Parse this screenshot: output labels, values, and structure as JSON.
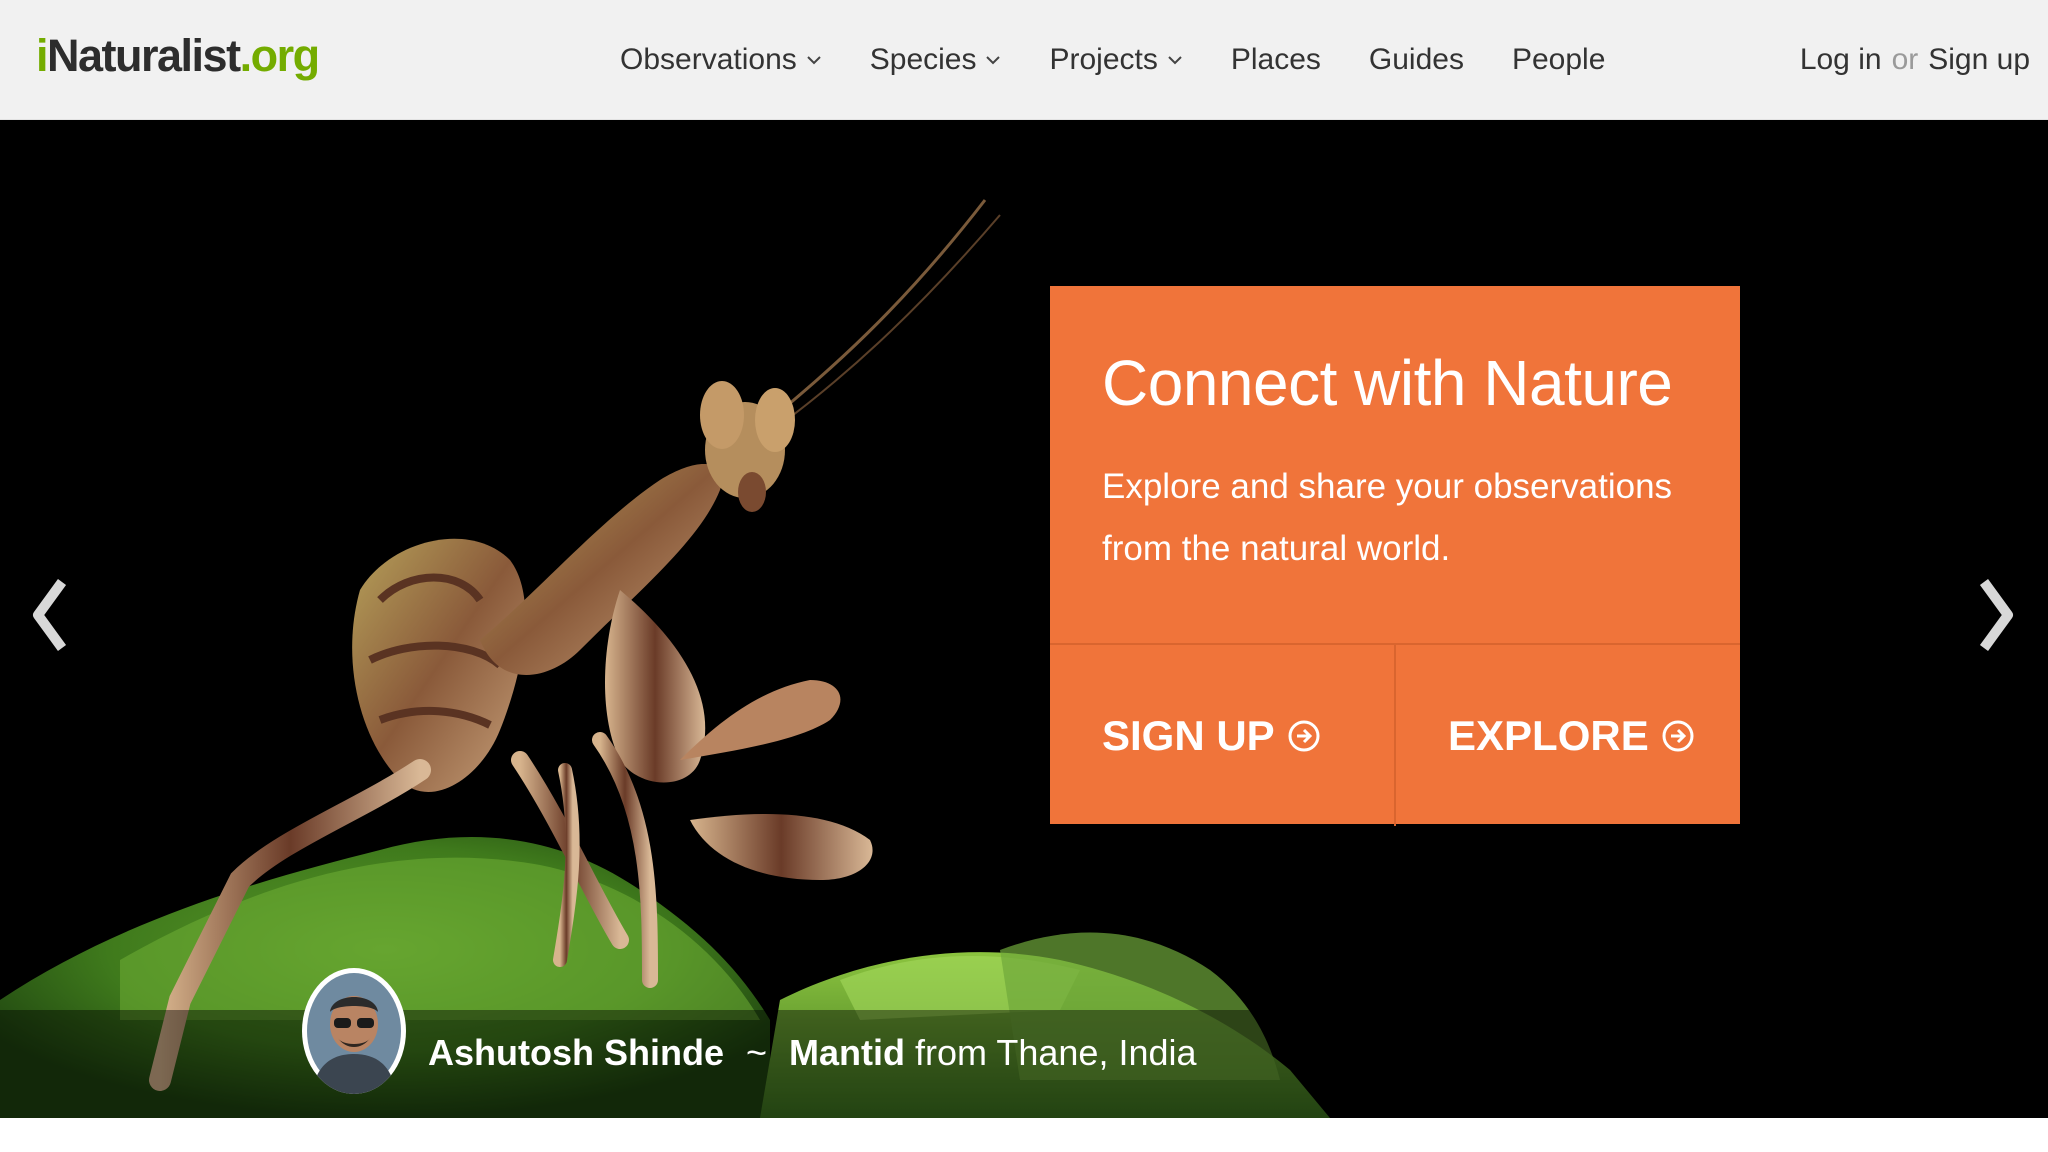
{
  "header": {
    "logo": {
      "prefix": "i",
      "main": "Naturalist",
      "suffix": ".org"
    },
    "nav": [
      {
        "label": "Observations",
        "has_dropdown": true,
        "icon": "chevron-down-icon"
      },
      {
        "label": "Species",
        "has_dropdown": true,
        "icon": "chevron-down-icon"
      },
      {
        "label": "Projects",
        "has_dropdown": true,
        "icon": "chevron-down-icon"
      },
      {
        "label": "Places",
        "has_dropdown": false
      },
      {
        "label": "Guides",
        "has_dropdown": false
      },
      {
        "label": "People",
        "has_dropdown": false
      }
    ],
    "auth": {
      "login": "Log in",
      "or": "or",
      "signup": "Sign up"
    }
  },
  "hero": {
    "title": "Connect with Nature",
    "subtitle": "Explore and share your observations from the natural world.",
    "signup_label": "SIGN UP",
    "explore_label": "EXPLORE",
    "button_icon": "circle-arrow-right-icon",
    "carousel_prev_icon": "chevron-left-icon",
    "carousel_next_icon": "chevron-right-icon",
    "caption": {
      "observer": "Ashutosh Shinde",
      "separator": "~",
      "taxon": "Mantid",
      "location_text": "from Thane, India"
    }
  },
  "colors": {
    "brand_green": "#74ac00",
    "cta_orange": "#f0743a",
    "header_bg": "#f1f1f1",
    "hero_bg": "#000000"
  }
}
